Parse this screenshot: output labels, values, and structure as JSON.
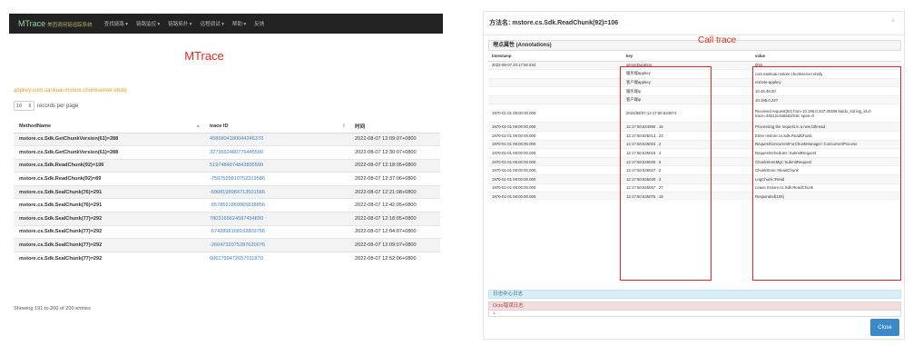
{
  "nav": {
    "brand": "MTrace",
    "brand_sub": "美团调用链追踪系统",
    "items": [
      "查找链路 ▾",
      "链路监控 ▾",
      "链路拓扑 ▾",
      "远程调试 ▾",
      "帮助 ▾",
      "反馈"
    ]
  },
  "main": {
    "title": "MTrace",
    "appkey": "appkey:com.sankuai.mstore.chunkserver.ebsbj",
    "per_page_value": "10",
    "per_page_label": "records per page",
    "columns": [
      "MethodName",
      "trace ID",
      "时间"
    ],
    "rows": [
      {
        "method": "mstore.cs.Sdk.GetChunkVersion(61)=288",
        "trace": "4586804180044246370",
        "time": "2022-08-07 12:09:07+0800"
      },
      {
        "method": "mstore.cs.Sdk.GetChunkVersion(61)=288",
        "trace": "3273692480776445500",
        "time": "2022-08-07 12:30:07+0800"
      },
      {
        "method": "mstore.cs.Sdk.ReadChunk(92)=106",
        "trace": "5197484074843835500",
        "time": "2022-08-07 12:18:05+0800"
      },
      {
        "method": "mstore.cs.Sdk.ReadChunk(92)=89",
        "trace": "-7597525810752319586",
        "time": "2022-08-07 12:37:06+0800"
      },
      {
        "method": "mstore.cs.Sdk.SealChunk(76)=291",
        "trace": "-5908198984713501566",
        "time": "2022-08-07 12:21:08+0800"
      },
      {
        "method": "mstore.cs.Sdk.SealChunk(76)=291",
        "trace": "-6578691869965838856",
        "time": "2022-08-07 12:42:05+0800"
      },
      {
        "method": "mstore.cs.Sdk.SealChunk(77)=292",
        "trace": "7803165624587454890",
        "time": "2022-08-07 12:18:05+0800"
      },
      {
        "method": "mstore.cs.Sdk.SealChunk(77)=292",
        "trace": "-5742896168192809756",
        "time": "2022-08-07 12:04:07+0800"
      },
      {
        "method": "mstore.cs.Sdk.SealChunk(77)=292",
        "trace": "-2604732075287620076",
        "time": "2022-08-07 12:09:07+0800"
      },
      {
        "method": "mstore.cs.Sdk.SealChunk(77)=292",
        "trace": "6061799472657011870",
        "time": "2022-08-07 12:52:06+0800"
      }
    ],
    "showing": "Showing 191 to 200 of 200 entries"
  },
  "modal": {
    "title": "方法名: mstore.cs.Sdk.ReadChunk(92)=106",
    "close_x": "×",
    "panel_title": "埋点属性 (Annotations)",
    "annotation": "Call trace",
    "columns": [
      "timestamp",
      "key",
      "value"
    ],
    "rows": [
      {
        "ts": "2022-08-07 20:17:50.534",
        "key": "serverDuration",
        "value": "0ms"
      },
      {
        "ts": "",
        "key": "服务端appkey",
        "value": "com.sankuai.mstore.chunkserver.ebsbj"
      },
      {
        "ts": "",
        "key": "客户端appkey",
        "value": "remote-appkey"
      },
      {
        "ts": "",
        "key": "服务端ip",
        "value": "10.46.48.20"
      },
      {
        "ts": "",
        "key": "客户端ip",
        "value": "10.195.0.237"
      },
      {
        "ts": "1970-01-01 08:00:00.000",
        "key": "2022/08/07-12:17:50.534974",
        "value": "Received request(92) from 10.195.0.237:30386 baidu_std log_id=0 trace=48212c3a66d10c6c span=0"
      },
      {
        "ts": "1970-01-01 08:00:00.000",
        "key": "12:17:50.534990 . 16",
        "value": "Processing the request in a new bthread"
      },
      {
        "ts": "1970-01-01 08:00:00.000",
        "key": "12:17:50.535013 . 23",
        "value": "Enter mstore.cs.Sdk.ReadChunk"
      },
      {
        "ts": "1970-01-01 08:00:00.000",
        "key": "12:17:50.535015 . 2",
        "value": "RequestConcurrentForChunkManager::ConcurrentProcess"
      },
      {
        "ts": "1970-01-01 08:00:00.000",
        "key": "12:17:50.535019 . 4",
        "value": "RequestScheduler::SubmitRequest"
      },
      {
        "ts": "1970-01-01 08:00:00.000",
        "key": "12:17:50.535025 . 6",
        "value": "ChunkStoreMgr::SubmitRequest"
      },
      {
        "ts": "1970-01-01 08:00:00.000",
        "key": "12:17:50.535027 . 2",
        "value": "ChunkStore::ReadChunk"
      },
      {
        "ts": "1970-01-01 08:00:00.000",
        "key": "12:17:50.535030 . 3",
        "value": "LogChunk::Read"
      },
      {
        "ts": "1970-01-01 08:00:00.000",
        "key": "12:17:50.535057 . 27",
        "value": "Leave mstore.cs.Sdk.ReadChunk"
      },
      {
        "ts": "1970-01-01 08:00:00.000",
        "key": "12:17:50.535075 . 18",
        "value": "Responded(106)"
      }
    ],
    "log_center": "日志中心日志",
    "octo_title": "Octo错误日志",
    "octo_body": "1.",
    "close_button": "Close"
  }
}
